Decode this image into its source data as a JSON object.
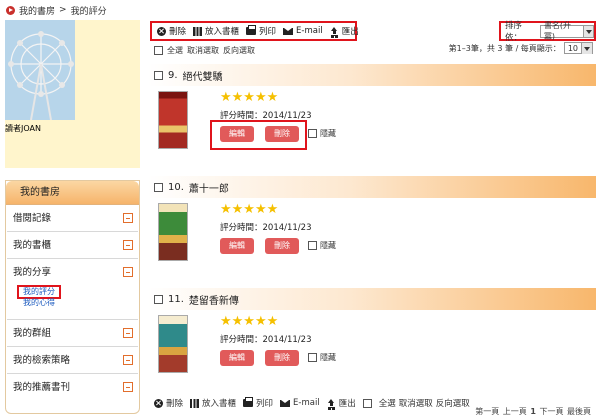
{
  "breadcrumb": {
    "home": "我的書房",
    "separator": ">",
    "current": "我的評分"
  },
  "profile": {
    "name": "讀者JOAN"
  },
  "sidebar": {
    "title": "我的書房",
    "items": [
      {
        "label": "借閱記錄"
      },
      {
        "label": "我的書櫃"
      },
      {
        "label": "我的分享",
        "subitems": [
          "我的評分",
          "我的心得"
        ]
      },
      {
        "label": "我的群組"
      },
      {
        "label": "我的檢索策略"
      },
      {
        "label": "我的推薦書刊"
      }
    ]
  },
  "toolbar": {
    "delete": "刪除",
    "add_to_shelf": "放入書櫃",
    "print": "列印",
    "email": "E-mail",
    "export": "匯出"
  },
  "sort": {
    "label": "排序依：",
    "value": "書名(升冪)"
  },
  "selection": {
    "select_all": "全選",
    "deselect": "取消選取",
    "invert": "反向選取"
  },
  "pager": {
    "summary": "第1–3筆，共 3 筆 / 每頁顯示：",
    "per_page": "10"
  },
  "books": [
    {
      "index": "9.",
      "title": "絕代雙驕",
      "stars": "★★★★★",
      "rating_date": "評分時間：2014/11/23",
      "edit": "編輯",
      "delete": "刪除",
      "hide": "隱藏",
      "cover_color": "#c0352b"
    },
    {
      "index": "10.",
      "title": "蕭十一郎",
      "stars": "★★★★★",
      "rating_date": "評分時間：2014/11/23",
      "edit": "編輯",
      "delete": "刪除",
      "hide": "隱藏",
      "cover_color": "#3d8b3a"
    },
    {
      "index": "11.",
      "title": "楚留香新傳",
      "stars": "★★★★★",
      "rating_date": "評分時間：2014/11/23",
      "edit": "編輯",
      "delete": "刪除",
      "hide": "隱藏",
      "cover_color": "#2f8a8a"
    }
  ],
  "footer_pager": {
    "first": "第一頁",
    "prev": "上一頁",
    "page": "1",
    "next": "下一頁",
    "last": "最後頁"
  },
  "colors": {
    "accent_red": "#e0141c",
    "button_red": "#e15a5a",
    "star_yellow": "#f5c000",
    "header_orange": "#f8b76c"
  }
}
